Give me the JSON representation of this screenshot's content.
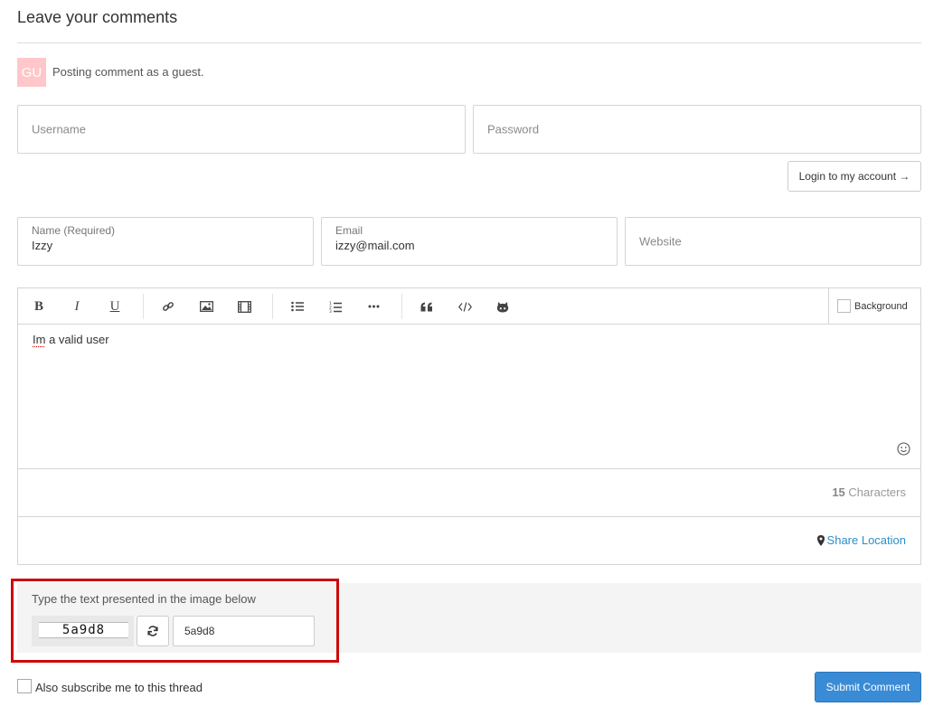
{
  "header": {
    "title": "Leave your comments"
  },
  "guest": {
    "avatar_initials": "GU",
    "note": "Posting comment as a guest."
  },
  "login": {
    "username_placeholder": "Username",
    "password_placeholder": "Password",
    "login_button": "Login to my account →"
  },
  "fields": {
    "name": {
      "label": "Name (Required)",
      "value": "Izzy"
    },
    "email": {
      "label": "Email",
      "value": "izzy@mail.com"
    },
    "website_placeholder": "Website"
  },
  "toolbar": {
    "bold": "B",
    "italic": "I",
    "underline": "U",
    "background_label": "Background"
  },
  "editor": {
    "text_misspelled": "Im",
    "text_rest": " a valid user",
    "char_count": "15",
    "char_label": " Characters",
    "share_location": "Share Location"
  },
  "captcha": {
    "prompt": "Type the text presented in the image below",
    "image_text": "5a9d8",
    "input_value": "5a9d8",
    "highlight_color": "#cc0b0b"
  },
  "footer": {
    "subscribe_label": "Also subscribe me to this thread",
    "submit_label": "Submit Comment"
  },
  "colors": {
    "accent": "#3a8bd6",
    "link": "#2a8fc9",
    "avatar_bg": "#ffc7c9"
  }
}
